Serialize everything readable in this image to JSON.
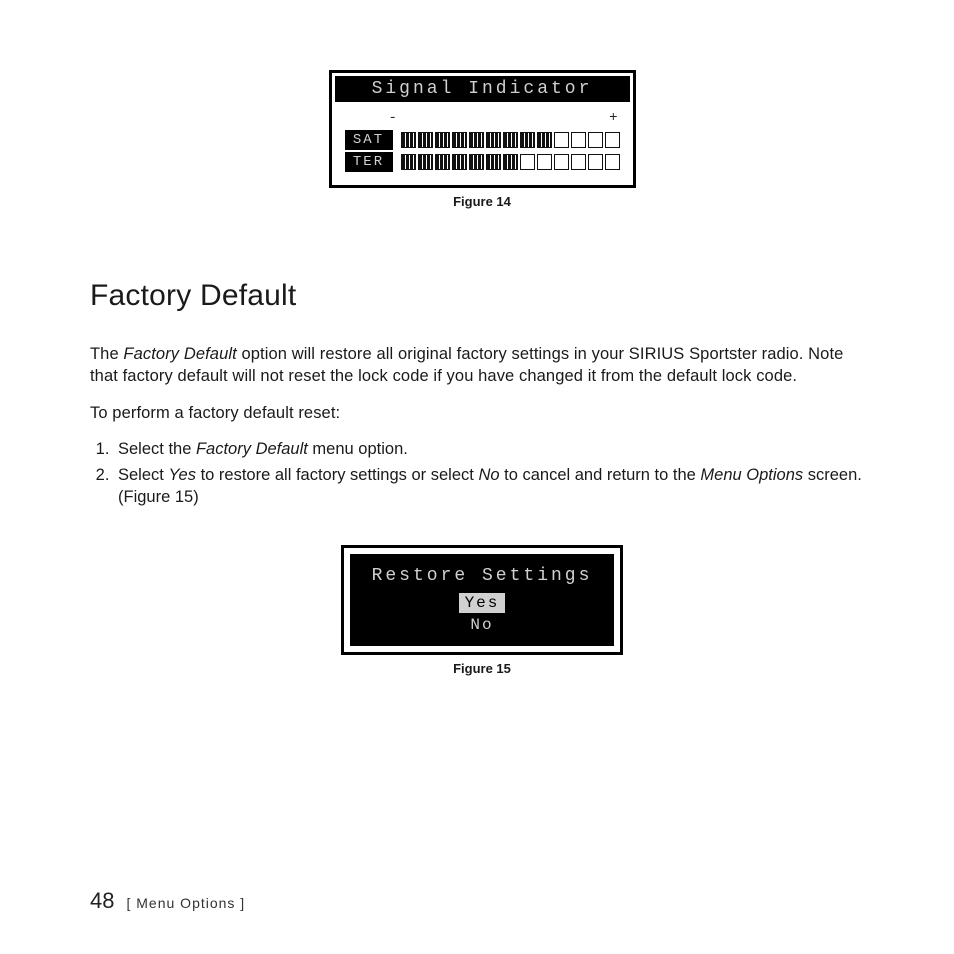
{
  "figure14": {
    "screen_title": "Signal Indicator",
    "scale": {
      "min": "-",
      "max": "+"
    },
    "rows": [
      {
        "label": "SAT",
        "cells": [
          1,
          1,
          1,
          1,
          1,
          1,
          1,
          1,
          1,
          0,
          0,
          0,
          0
        ]
      },
      {
        "label": "TER",
        "cells": [
          1,
          1,
          1,
          1,
          1,
          1,
          1,
          0,
          0,
          0,
          0,
          0,
          0
        ]
      }
    ],
    "caption": "Figure 14"
  },
  "section": {
    "heading": "Factory Default",
    "para1_a": "The ",
    "para1_b_italic": "Factory Default",
    "para1_c": " option will restore all original factory settings in your SIRIUS Sportster radio. Note that factory default will not reset the lock code if you have changed it from the default lock code.",
    "para2": "To perform a factory default reset:",
    "steps": [
      {
        "a": "Select the ",
        "b_italic": "Factory Default",
        "c": " menu option."
      },
      {
        "a": "Select ",
        "b_italic": "Yes",
        "c": " to restore all factory settings or select ",
        "d_italic": "No",
        "e": " to cancel and return to the ",
        "f_italic": "Menu Options",
        "g": " screen. (Figure 15)"
      }
    ]
  },
  "figure15": {
    "screen_title": "Restore Settings",
    "option_yes": "Yes",
    "option_no": "No",
    "caption": "Figure 15"
  },
  "footer": {
    "page_number": "48",
    "section_label": "[ Menu Options ]"
  }
}
